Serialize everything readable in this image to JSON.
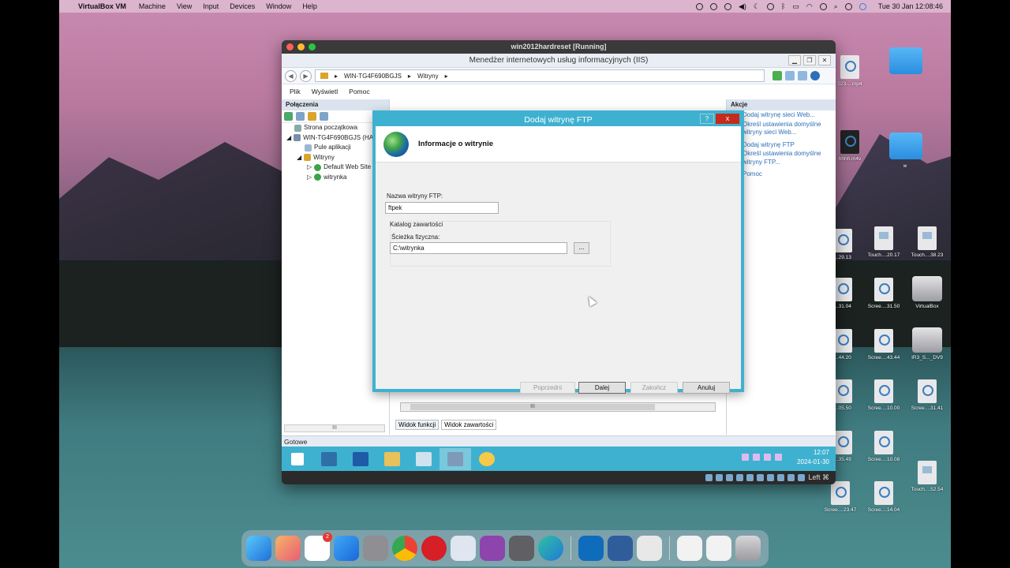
{
  "mac_menubar": {
    "app_name": "VirtualBox VM",
    "menus": [
      "Machine",
      "View",
      "Input",
      "Devices",
      "Window",
      "Help"
    ],
    "clock": "Tue 30 Jan  12:08:46"
  },
  "vbox": {
    "title": "win2012hardreset [Running]",
    "host_key": "Left ⌘"
  },
  "iis": {
    "title": "Menedżer internetowych usług informacyjnych (IIS)",
    "address": [
      "WIN-TG4F690BGJS",
      "Witryny"
    ],
    "menu": [
      "Plik",
      "Wyświetl",
      "Pomoc"
    ],
    "connections": {
      "header": "Połączenia",
      "tree": [
        "Strona początkowa",
        "WIN-TG4F690BGJS (HA",
        "Pule aplikacji",
        "Witryny",
        "Default Web Site",
        "witrynka"
      ]
    },
    "center_tabs": [
      "Widok funkcji",
      "Widok zawartości"
    ],
    "actions": {
      "header": "Akcje",
      "items": [
        "Dodaj witrynę sieci Web...",
        "Określ ustawienia domyślne witryny sieci Web...",
        "Dodaj witrynę FTP",
        "Określ ustawienia domyślne witryny FTP...",
        "Pomoc"
      ]
    },
    "status": "Gotowe"
  },
  "dialog": {
    "title": "Dodaj witrynę FTP",
    "help_btn": "?",
    "close_btn": "x",
    "header": "Informacje o witrynie",
    "site_name_label": "Nazwa witryny FTP:",
    "site_name_value": "ftpek",
    "content_dir_label": "Katalog zawartości",
    "physical_path_label": "Ścieżka fizyczna:",
    "physical_path_value": "C:\\witrynka",
    "browse_label": "...",
    "buttons": {
      "prev": "Poprzedni",
      "next": "Dalej",
      "finish": "Zakończ",
      "cancel": "Anuluj"
    }
  },
  "win_taskbar": {
    "time": "12:07",
    "date": "2024-01-30"
  },
  "desktop_icons": [
    {
      "label": "023-...mp4",
      "tag": "MP4"
    },
    {
      "label": "hhhh.m4v",
      "tag": "M4V"
    },
    {
      "label": "w"
    },
    {
      "label": "...29.13",
      "tag": "MOV"
    },
    {
      "label": "Touch....20.17",
      "tag": "PNG"
    },
    {
      "label": "Touch....38.23",
      "tag": "PNG"
    },
    {
      "label": "...31.04",
      "tag": "MOV"
    },
    {
      "label": "Scree....31.50",
      "tag": "MOV"
    },
    {
      "label": "VirtualBox"
    },
    {
      "label": "...44.20",
      "tag": "MOV"
    },
    {
      "label": "Scree....43.44",
      "tag": "MOV"
    },
    {
      "label": "IR3_S..._DV9"
    },
    {
      "label": "...05.50",
      "tag": "MOV"
    },
    {
      "label": "Scree....10.00",
      "tag": "MOV"
    },
    {
      "label": "Scree....31.41",
      "tag": "MOV"
    },
    {
      "label": "...35.49",
      "tag": "MOV"
    },
    {
      "label": "Scree....10.08",
      "tag": "MOV"
    },
    {
      "label": "Scree....23.47",
      "tag": "MOV"
    },
    {
      "label": "Scree....14.04",
      "tag": "MOV"
    },
    {
      "label": "Touch....52.54",
      "tag": "PNG"
    }
  ],
  "dock": {
    "reminders_badge": "2"
  },
  "colors": {
    "win_accent": "#3fb1d0",
    "link": "#2d6fb8",
    "close_red": "#c42b1c"
  }
}
